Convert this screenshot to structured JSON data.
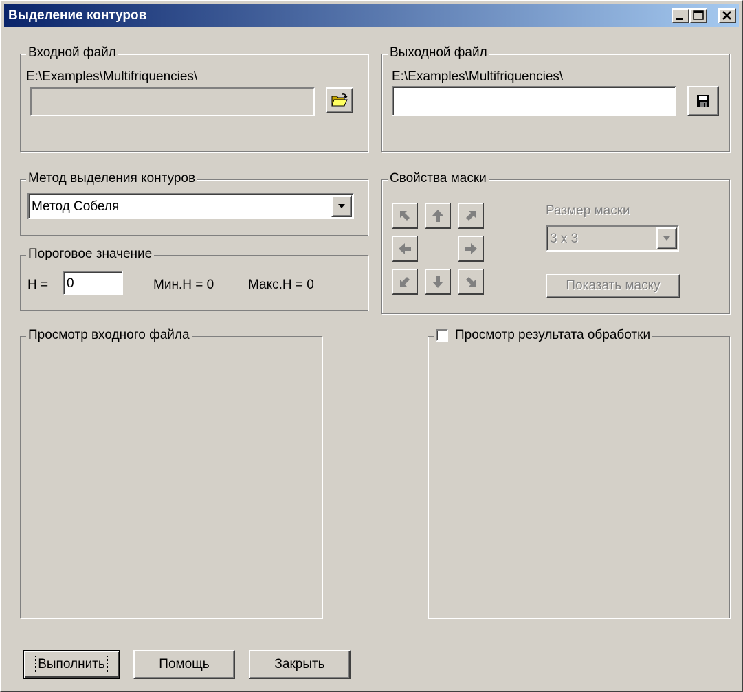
{
  "window": {
    "title": "Выделение контуров",
    "controls": {
      "minimize": "_",
      "close": "×"
    }
  },
  "input_file": {
    "legend": "Входной файл",
    "path": "E:\\Examples\\Multifriquencies\\",
    "value": "",
    "open_icon": "folder-open-icon"
  },
  "output_file": {
    "legend": "Выходной файл",
    "path": "E:\\Examples\\Multifriquencies\\",
    "value": "",
    "save_icon": "floppy-disk-icon"
  },
  "method": {
    "legend": "Метод выделения контуров",
    "selected": "Метод Собеля"
  },
  "threshold": {
    "legend": "Пороговое значение",
    "h_label": "H =",
    "h_value": "0",
    "min_label": "Мин.H = 0",
    "max_label": "Макс.H = 0"
  },
  "mask": {
    "legend": "Свойства маски",
    "size_label": "Размер маски",
    "size_value": "3 x 3",
    "show_button": "Показать маску"
  },
  "preview_input": {
    "legend": "Просмотр входного файла"
  },
  "preview_output": {
    "legend": "Просмотр результата обработки",
    "checked": false
  },
  "buttons": {
    "run": "Выполнить",
    "help": "Помощь",
    "close": "Закрыть"
  },
  "colors": {
    "face": "#d4d0c8",
    "title_start": "#0a246a",
    "title_end": "#a6caf0",
    "disabled": "#808080"
  }
}
